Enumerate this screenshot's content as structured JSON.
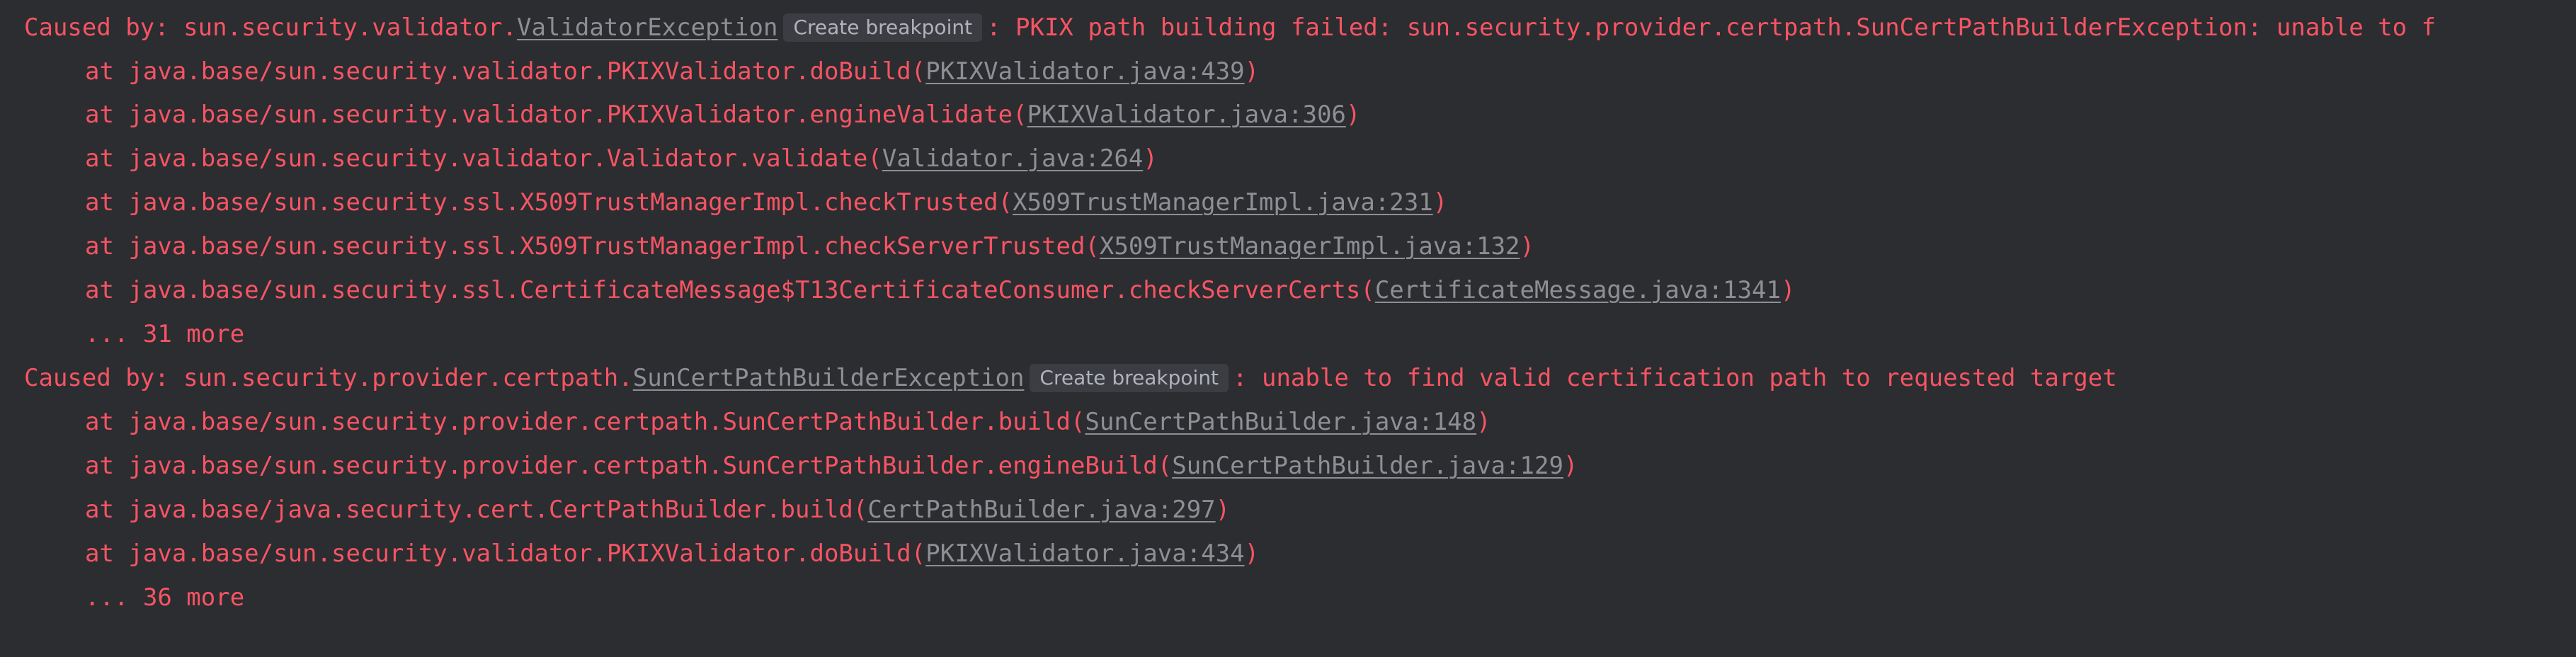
{
  "lines": [
    {
      "prefix": "Caused by: sun.security.validator.",
      "link": "ValidatorException",
      "badge": "Create breakpoint",
      "suffix": ": PKIX path building failed: sun.security.provider.certpath.SunCertPathBuilderException: unable to f"
    },
    {
      "prefix": "at java.base/sun.security.validator.PKIXValidator.doBuild(",
      "link": "PKIXValidator.java:439",
      "suffix": ")"
    },
    {
      "prefix": "at java.base/sun.security.validator.PKIXValidator.engineValidate(",
      "link": "PKIXValidator.java:306",
      "suffix": ")"
    },
    {
      "prefix": "at java.base/sun.security.validator.Validator.validate(",
      "link": "Validator.java:264",
      "suffix": ")"
    },
    {
      "prefix": "at java.base/sun.security.ssl.X509TrustManagerImpl.checkTrusted(",
      "link": "X509TrustManagerImpl.java:231",
      "suffix": ")"
    },
    {
      "prefix": "at java.base/sun.security.ssl.X509TrustManagerImpl.checkServerTrusted(",
      "link": "X509TrustManagerImpl.java:132",
      "suffix": ")"
    },
    {
      "prefix": "at java.base/sun.security.ssl.CertificateMessage$T13CertificateConsumer.checkServerCerts(",
      "link": "CertificateMessage.java:1341",
      "suffix": ")"
    },
    {
      "text": "... 31 more"
    },
    {
      "prefix": "Caused by: sun.security.provider.certpath.",
      "link": "SunCertPathBuilderException",
      "badge": "Create breakpoint",
      "suffix": ": unable to find valid certification path to requested target"
    },
    {
      "prefix": "at java.base/sun.security.provider.certpath.SunCertPathBuilder.build(",
      "link": "SunCertPathBuilder.java:148",
      "suffix": ")"
    },
    {
      "prefix": "at java.base/sun.security.provider.certpath.SunCertPathBuilder.engineBuild(",
      "link": "SunCertPathBuilder.java:129",
      "suffix": ")"
    },
    {
      "prefix": "at java.base/java.security.cert.CertPathBuilder.build(",
      "link": "CertPathBuilder.java:297",
      "suffix": ")"
    },
    {
      "prefix": "at java.base/sun.security.validator.PKIXValidator.doBuild(",
      "link": "PKIXValidator.java:434",
      "suffix": ")"
    },
    {
      "text": "... 36 more"
    }
  ],
  "colors": {
    "background": "#2b2d30",
    "error_text": "#f75464",
    "link_text": "#8e8f94",
    "badge_background": "#3b3d42",
    "badge_text": "#b0b3ba"
  }
}
